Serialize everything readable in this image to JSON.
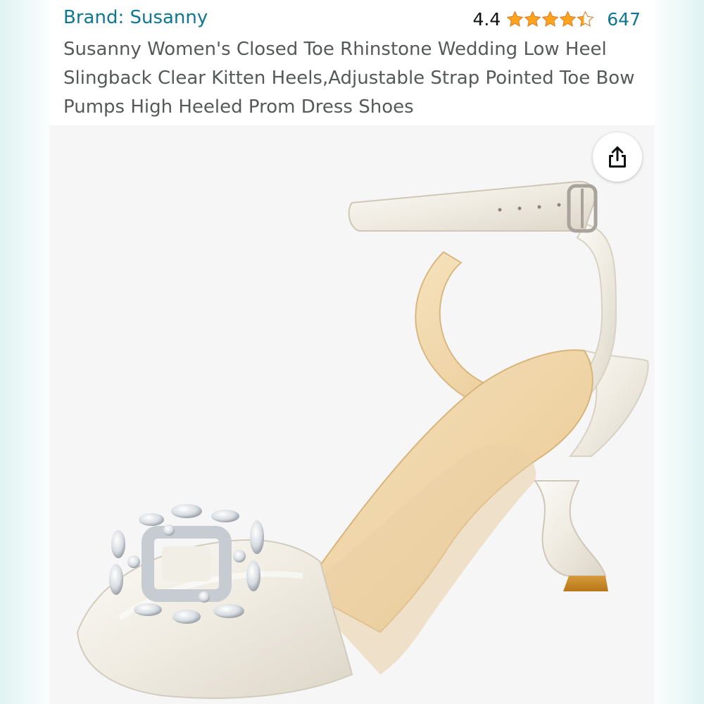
{
  "product": {
    "brand_label": "Brand: Susanny",
    "rating": "4.4",
    "rating_stars": 4.4,
    "review_count": "647",
    "title": "Susanny Women's Closed Toe Rhinstone Wedding Low Heel Slingback Clear Kitten Heels,Adjustable Strap Pointed Toe Bow Pumps High Heeled Prom Dress Shoes"
  },
  "icons": {
    "share": "share-icon",
    "star": "star-icon"
  },
  "colors": {
    "link": "#0f7791",
    "star": "#ffa41c",
    "title": "#565959"
  }
}
